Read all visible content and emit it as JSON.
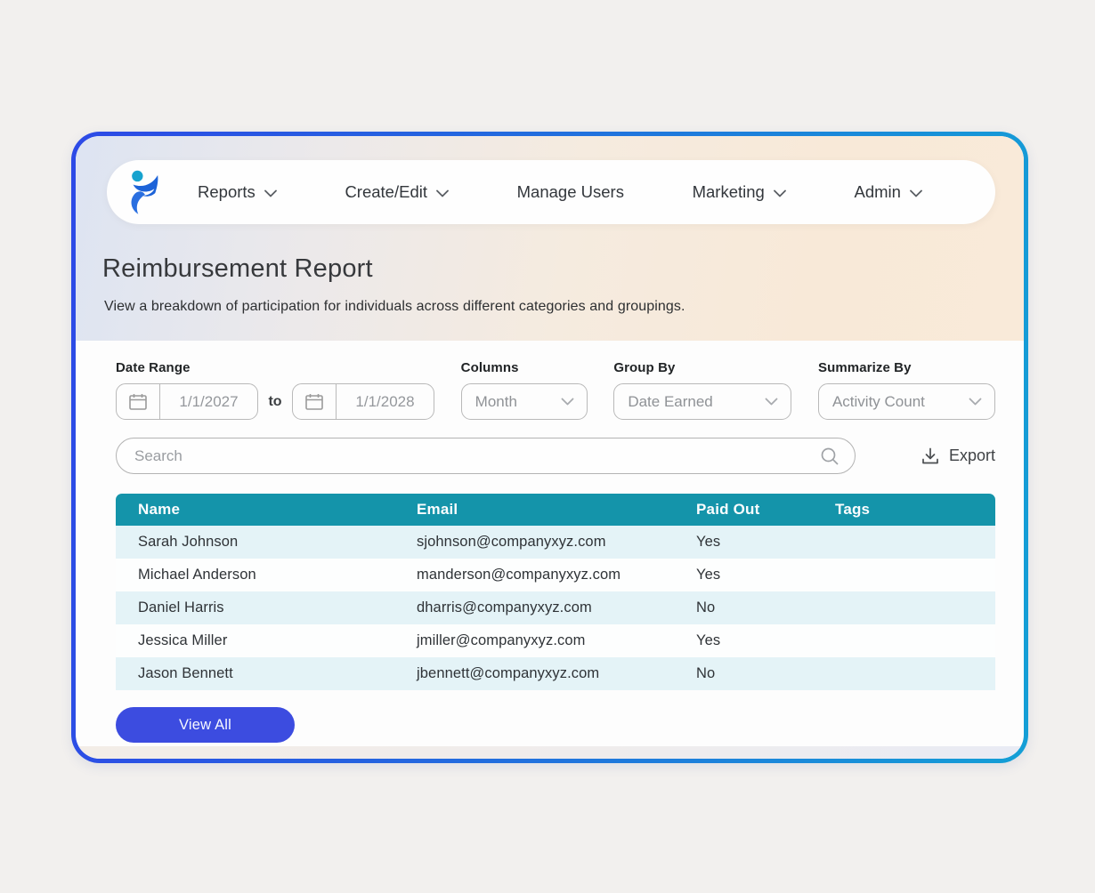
{
  "nav": {
    "items": [
      {
        "label": "Reports",
        "has_dropdown": true
      },
      {
        "label": "Create/Edit",
        "has_dropdown": true
      },
      {
        "label": "Manage Users",
        "has_dropdown": false
      },
      {
        "label": "Marketing",
        "has_dropdown": true
      },
      {
        "label": "Admin",
        "has_dropdown": true
      }
    ]
  },
  "page": {
    "title": "Reimbursement Report",
    "subtitle": "View a breakdown of participation for individuals across different categories and groupings."
  },
  "filters": {
    "date_range": {
      "label": "Date Range",
      "from_value": "1/1/2027",
      "separator": "to",
      "to_value": "1/1/2028"
    },
    "columns": {
      "label": "Columns",
      "value": "Month"
    },
    "group_by": {
      "label": "Group By",
      "value": "Date Earned"
    },
    "summarize_by": {
      "label": "Summarize By",
      "value": "Activity Count"
    }
  },
  "search": {
    "placeholder": "Search"
  },
  "toolbar": {
    "export_label": "Export"
  },
  "table": {
    "columns": [
      "Name",
      "Email",
      "Paid Out",
      "Tags"
    ],
    "rows": [
      {
        "name": "Sarah Johnson",
        "email": "sjohnson@companyxyz.com",
        "paid_out": "Yes",
        "tags": ""
      },
      {
        "name": "Michael Anderson",
        "email": "manderson@companyxyz.com",
        "paid_out": "Yes",
        "tags": ""
      },
      {
        "name": "Daniel Harris",
        "email": "dharris@companyxyz.com",
        "paid_out": "No",
        "tags": ""
      },
      {
        "name": "Jessica Miller",
        "email": "jmiller@companyxyz.com",
        "paid_out": "Yes",
        "tags": ""
      },
      {
        "name": "Jason Bennett",
        "email": "jbennett@companyxyz.com",
        "paid_out": "No",
        "tags": ""
      }
    ]
  },
  "actions": {
    "view_all_label": "View All"
  },
  "colors": {
    "table_header": "#1494aa",
    "row_alt": "#e4f3f7",
    "view_all_button": "#3c4ce0",
    "border_gradient_start": "#2d4ae6",
    "border_gradient_end": "#149fd6",
    "hero_left": "#dde4f2",
    "hero_right": "#f9ead9",
    "logo_blue": "#1d63d8",
    "logo_teal": "#17a3cf"
  }
}
